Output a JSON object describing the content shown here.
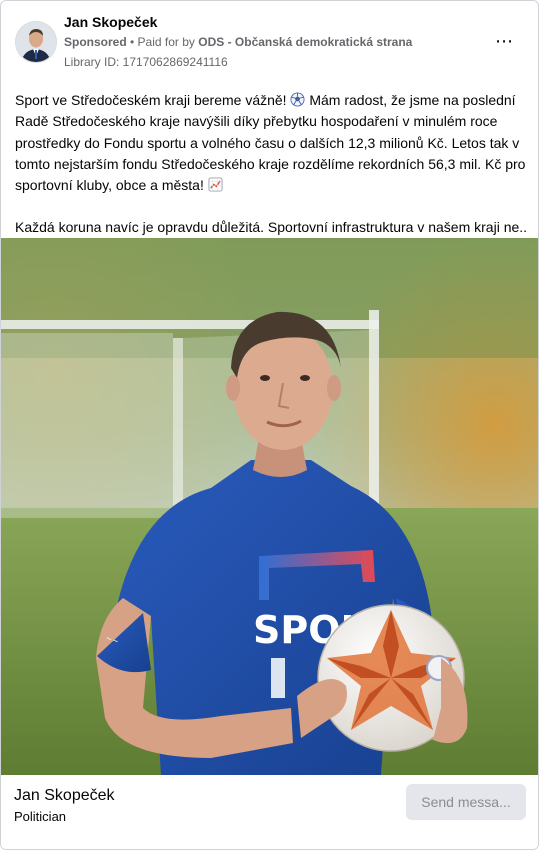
{
  "post": {
    "author": "Jan Skopeček",
    "sponsored_label": "Sponsored",
    "separator": " • ",
    "paid_prefix": "Paid for by ",
    "paid_by": "ODS - Občanská demokratická strana",
    "library_id": "Library ID: 1717062869241116",
    "more_icon": "⋯",
    "paragraph1_a": "Sport ve Středočeském kraji bereme vážně! ",
    "paragraph1_b": "  Mám radost, že jsme na poslední Radě Středočeského kraje navýšili díky přebytku hospodaření v minulém roce prostředky do Fondu sportu a volného času o dalších 12,3 milionů Kč. Letos tak v tomto nejstarším fondu Středočeského kraje rozdělíme rekordních 56,3 mil. Kč pro sportovní kluby, obce a města! ",
    "paragraph2": "Každá koruna navíc je opravdu důležitá. Sportovní infrastruktura v našem kraji ne..."
  },
  "photo": {
    "jersey_text": "SPOLU"
  },
  "footer": {
    "page_name": "Jan Skopeček",
    "category": "Politician",
    "send_button": "Send messa..."
  },
  "colors": {
    "shirt": "#1f4fae",
    "ball_orange": "#e0743a",
    "grass": "#6b8a3a"
  },
  "icons": [
    "more-options-icon",
    "soccer-ball-emoji-icon",
    "chart-increasing-emoji-icon"
  ]
}
